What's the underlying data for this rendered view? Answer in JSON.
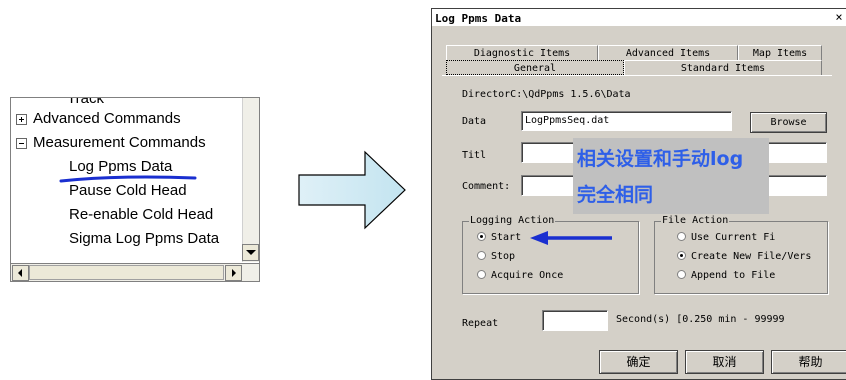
{
  "tree": {
    "items": [
      {
        "label": "Track",
        "expander": ""
      },
      {
        "label": "Advanced Commands",
        "expander": "plus"
      },
      {
        "label": "Measurement Commands",
        "expander": "minus"
      },
      {
        "label": "Log Ppms Data",
        "expander": ""
      },
      {
        "label": "Pause Cold Head",
        "expander": ""
      },
      {
        "label": "Re-enable Cold Head",
        "expander": ""
      },
      {
        "label": "Sigma Log Ppms Data",
        "expander": ""
      }
    ],
    "highlight_color": "#1a2fd0"
  },
  "dialog": {
    "title": "Log Ppms Data",
    "close": "×",
    "tabs": {
      "diagnostic": "Diagnostic Items",
      "advanced": "Advanced Items",
      "map": "Map Items",
      "general": "General",
      "standard": "Standard Items"
    },
    "directory_label": "Director",
    "directory_value": "C:\\QdPpms 1.5.6\\Data",
    "data_label": "Data",
    "data_value": "LogPpmsSeq.dat",
    "browse": "Browse",
    "title_label": "Titl",
    "comment_label": "Comment:",
    "logging_action": {
      "title": "Logging Action",
      "options": [
        "Start",
        "Stop",
        "Acquire Once"
      ],
      "selected": "Start"
    },
    "file_action": {
      "title": "File Action",
      "options": [
        "Use Current Fi",
        "Create New File/Vers",
        "Append to File"
      ],
      "selected": "Create New File/Vers"
    },
    "repeat_label": "Repeat",
    "repeat_unit": "Second(s) [0.250 min - 99999",
    "ok": "确定",
    "cancel": "取消",
    "help": "帮助"
  },
  "annotation": {
    "line1": "相关设置和手动log",
    "line2": "完全相同",
    "color": "#2e5fe8"
  }
}
